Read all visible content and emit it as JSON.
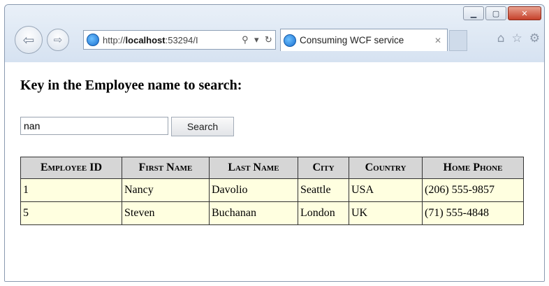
{
  "browser": {
    "window_controls": {
      "minimize_icon": "minimize-icon",
      "maximize_icon": "maximize-icon",
      "close_icon": "close-icon"
    },
    "address_bar": {
      "url_prefix": "http://",
      "url_host": "localhost",
      "url_rest": ":53294/I"
    },
    "tab": {
      "title": "Consuming WCF service"
    },
    "toolbar_icons": [
      "home-icon",
      "favorites-star-icon",
      "settings-gear-icon"
    ]
  },
  "page": {
    "heading": "Key in the Employee name to search:",
    "search": {
      "value": "nan",
      "button_label": "Search"
    },
    "table": {
      "columns": [
        "Employee ID",
        "First Name",
        "Last Name",
        "City",
        "Country",
        "Home Phone"
      ],
      "rows": [
        [
          "1",
          "Nancy",
          "Davolio",
          "Seattle",
          "USA",
          "(206) 555-9857"
        ],
        [
          "5",
          "Steven",
          "Buchanan",
          "London",
          "UK",
          "(71) 555-4848"
        ]
      ]
    }
  }
}
